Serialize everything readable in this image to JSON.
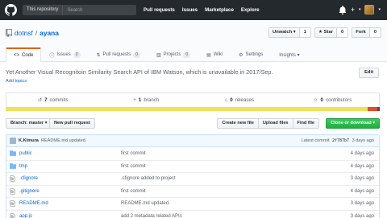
{
  "header": {
    "search_scope": "This repository",
    "search_placeholder": "Search",
    "nav": [
      "Pull requests",
      "Issues",
      "Marketplace",
      "Explore"
    ]
  },
  "repo": {
    "owner": "dotnsf",
    "separator": "/",
    "name": "ayana",
    "watch": {
      "label": "Unwatch ▾",
      "count": "1"
    },
    "star": {
      "label": "★ Star",
      "count": "0"
    },
    "fork": {
      "label": "Fork",
      "count": "0"
    }
  },
  "tabs": [
    {
      "label": "Code",
      "icon": "code-icon",
      "counter": ""
    },
    {
      "label": "Issues",
      "icon": "issue-icon",
      "counter": "0"
    },
    {
      "label": "Pull requests",
      "icon": "pull-request-icon",
      "counter": "0"
    },
    {
      "label": "Projects",
      "icon": "project-icon",
      "counter": "0"
    },
    {
      "label": "Wiki",
      "icon": "book-icon",
      "counter": ""
    },
    {
      "label": "Settings",
      "icon": "gear-icon",
      "counter": ""
    },
    {
      "label": "Insights ▾",
      "icon": "",
      "counter": ""
    }
  ],
  "description": "Yet Another Visual Recognitoin Similarity Search API of IBM Watson, which is unavailable in 2017/Sep.",
  "add_topics": "Add topics",
  "edit_label": "Edit",
  "summary": {
    "commits": {
      "count": "7",
      "label": "commits"
    },
    "branches": {
      "count": "1",
      "label": "branch"
    },
    "releases": {
      "count": "0",
      "label": "releases"
    },
    "contributors": {
      "count": "0",
      "label": "contributors"
    }
  },
  "languages": [
    {
      "color": "#f1e05a",
      "share": 0.968
    },
    {
      "color": "#e34c26",
      "share": 0.025
    },
    {
      "color": "#563d7c",
      "share": 0.007
    }
  ],
  "file_nav": {
    "branch": "Branch: master ▾",
    "new_pr": "New pull request",
    "create_file": "Create new file",
    "upload": "Upload files",
    "find": "Find file",
    "clone": "Clone or download ▾"
  },
  "commit_tease": {
    "author": "K.Kimura",
    "message": "README.md updated.",
    "latest_label": "Latest commit",
    "sha": "2f787b7",
    "age": "3 days ago"
  },
  "files": [
    {
      "type": "dir",
      "name": "public",
      "message": "first commit",
      "age": "4 days ago"
    },
    {
      "type": "dir",
      "name": "tmp",
      "message": "first commit",
      "age": "4 days ago"
    },
    {
      "type": "file",
      "name": ".cfignore",
      "message": ".cfignore added to project",
      "age": "3 days ago"
    },
    {
      "type": "file",
      "name": ".gitignore",
      "message": "first commit",
      "age": "4 days ago"
    },
    {
      "type": "file",
      "name": "README.md",
      "message": "README.md updated.",
      "age": "3 days ago"
    },
    {
      "type": "file",
      "name": "app.js",
      "message": "add 2 metadata related APIs",
      "age": "3 days ago"
    }
  ]
}
